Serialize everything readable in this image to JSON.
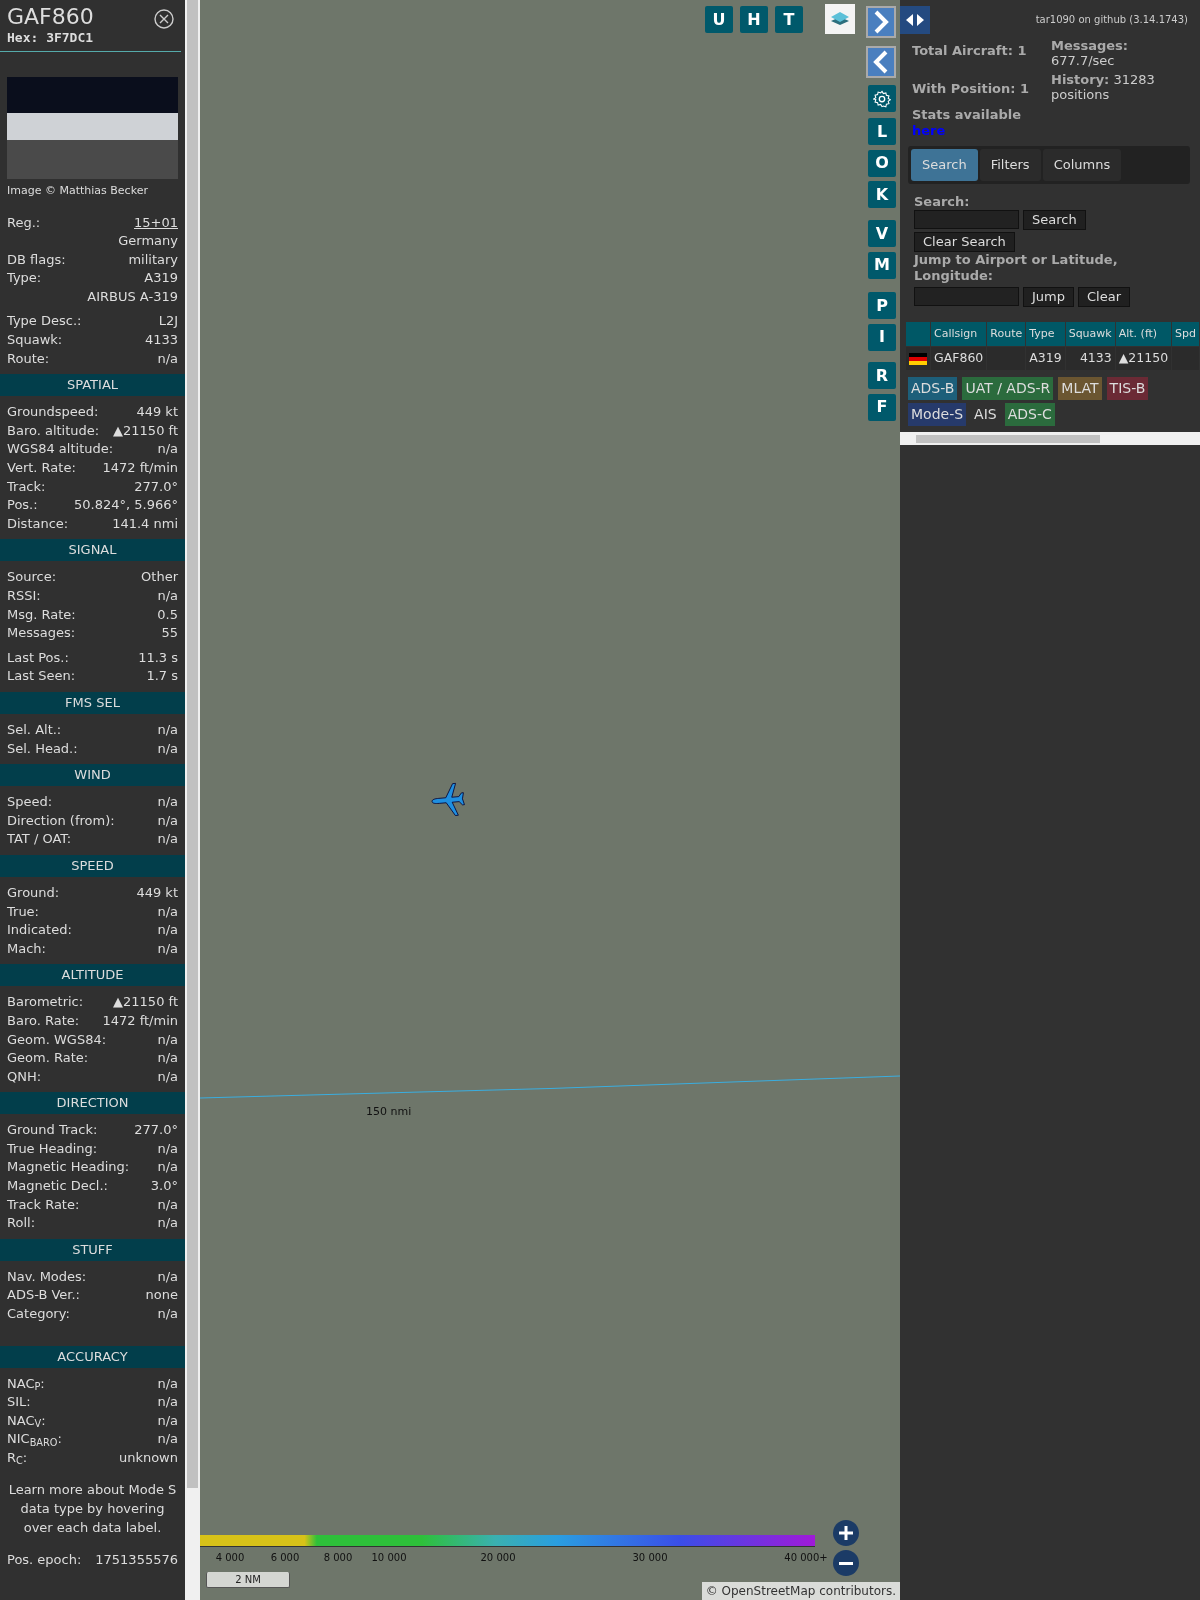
{
  "aircraft": {
    "callsign": "GAF860",
    "hex": "Hex: 3F7DC1",
    "image_credit": "Image © Matthias Becker",
    "groups": [
      [
        {
          "label": "Reg.:",
          "value": "15+01",
          "kind": "link"
        },
        {
          "value": "Germany"
        },
        {
          "label": "DB flags:",
          "value": "military"
        },
        {
          "label": "Type:",
          "value": "A319"
        },
        {
          "value": "AIRBUS A-319"
        }
      ],
      [
        {
          "label": "Type Desc.:",
          "value": "L2J"
        },
        {
          "label": "Squawk:",
          "value": "4133"
        },
        {
          "label": "Route:",
          "value": "n/a"
        }
      ]
    ]
  },
  "sections": [
    {
      "title": "SPATIAL",
      "groups": [
        [
          {
            "label": "Groundspeed:",
            "value": "449 kt"
          },
          {
            "label": "Baro. altitude:",
            "value": "▲21150 ft"
          },
          {
            "label": "WGS84 altitude:",
            "value": "n/a"
          },
          {
            "label": "Vert. Rate:",
            "value": "1472 ft/min"
          },
          {
            "label": "Track:",
            "value": "277.0°"
          },
          {
            "label": "Pos.:",
            "value": "50.824°, 5.966°"
          },
          {
            "label": "Distance:",
            "value": "141.4 nmi"
          }
        ]
      ]
    },
    {
      "title": "SIGNAL",
      "groups": [
        [
          {
            "label": "Source:",
            "value": "Other"
          },
          {
            "label": "RSSI:",
            "value": "n/a"
          },
          {
            "label": "Msg. Rate:",
            "value": "0.5"
          },
          {
            "label": "Messages:",
            "value": "55"
          }
        ],
        [
          {
            "label": "Last Pos.:",
            "value": "11.3 s"
          },
          {
            "label": "Last Seen:",
            "value": "1.7 s"
          }
        ]
      ]
    },
    {
      "title": "FMS SEL",
      "groups": [
        [
          {
            "label": "Sel. Alt.:",
            "value": "n/a"
          },
          {
            "label": "Sel. Head.:",
            "value": "n/a"
          }
        ]
      ]
    },
    {
      "title": "WIND",
      "groups": [
        [
          {
            "label": "Speed:",
            "value": "n/a"
          },
          {
            "label": "Direction (from):",
            "value": "n/a"
          },
          {
            "label": "TAT / OAT:",
            "value": "n/a"
          }
        ]
      ]
    },
    {
      "title": "SPEED",
      "groups": [
        [
          {
            "label": "Ground:",
            "value": "449 kt"
          },
          {
            "label": "True:",
            "value": "n/a"
          },
          {
            "label": "Indicated:",
            "value": "n/a"
          },
          {
            "label": "Mach:",
            "value": "n/a"
          }
        ]
      ]
    },
    {
      "title": "ALTITUDE",
      "groups": [
        [
          {
            "label": "Barometric:",
            "value": "▲21150 ft"
          },
          {
            "label": "Baro. Rate:",
            "value": "1472 ft/min"
          },
          {
            "label": "Geom. WGS84:",
            "value": "n/a"
          },
          {
            "label": "Geom. Rate:",
            "value": "n/a"
          },
          {
            "label": "QNH:",
            "value": "n/a"
          }
        ]
      ]
    },
    {
      "title": "DIRECTION",
      "groups": [
        [
          {
            "label": "Ground Track:",
            "value": "277.0°"
          },
          {
            "label": "True Heading:",
            "value": "n/a"
          },
          {
            "label": "Magnetic Heading:",
            "value": "n/a"
          },
          {
            "label": "Magnetic Decl.:",
            "value": "3.0°"
          },
          {
            "label": "Track Rate:",
            "value": "n/a"
          },
          {
            "label": "Roll:",
            "value": "n/a"
          }
        ]
      ]
    },
    {
      "title": "STUFF",
      "groups": [
        [
          {
            "label": "Nav. Modes:",
            "value": "n/a"
          },
          {
            "label": "ADS-B Ver.:",
            "value": "none"
          },
          {
            "label": "Category:",
            "value": "n/a"
          }
        ]
      ]
    },
    {
      "title": "ACCURACY",
      "groups": [
        [
          {
            "label": "NAC$_{P}$:",
            "value": "n/a"
          },
          {
            "label": "SIL:",
            "value": "n/a"
          },
          {
            "label": "NAC$_{V}$:",
            "value": "n/a"
          },
          {
            "label": "NIC$_{BARO}$:",
            "value": "n/a"
          },
          {
            "label": "R$_{C}$:",
            "value": "unknown"
          }
        ]
      ]
    }
  ],
  "note": "Learn more about Mode S data type by hovering over each data label.",
  "epoch": {
    "label": "Pos. epoch:",
    "value": "1751355576"
  },
  "map": {
    "top_buttons": [
      "U",
      "H",
      "T"
    ],
    "side_buttons": [
      [
        "L",
        "O",
        "K"
      ],
      [
        "V",
        "M"
      ],
      [
        "P",
        "I"
      ],
      [
        "R",
        "F"
      ]
    ],
    "range_label": "150 nmi",
    "altitude_labels": [
      "4 000",
      "6 000",
      "8 000",
      "10 000",
      "20 000",
      "30 000",
      "40 000+"
    ],
    "scale": "2 NM",
    "attribution_prefix": "©",
    "attribution_link": "OpenStreetMap",
    "attribution_suffix": "contributors."
  },
  "panel": {
    "github": "tar1090 on github (3.14.1743)",
    "stats_left": [
      {
        "label": "Total Aircraft:",
        "value": "1"
      },
      {
        "label": "With Position:",
        "value": "1"
      }
    ],
    "stats_right": [
      {
        "label": "Messages:",
        "value": "677.7/sec"
      },
      {
        "label": "History:",
        "value": "31283 positions"
      }
    ],
    "stats_note": "Stats available",
    "stats_link": "here",
    "tabs": [
      {
        "label": "Search",
        "selected": true
      },
      {
        "label": "Filters",
        "selected": false
      },
      {
        "label": "Columns",
        "selected": false
      }
    ],
    "search_label": "Search:",
    "search_button": "Search",
    "clear_search": "Clear Search",
    "jump_label": "Jump to Airport or Latitude, Longitude:",
    "jump_button": "Jump",
    "clear_button": "Clear",
    "table": {
      "columns": [
        "Callsign",
        "Route",
        "Type",
        "Squawk",
        "Alt. (ft)",
        "Spd"
      ],
      "rows": [
        {
          "callsign": "GAF860",
          "route": "",
          "type": "A319",
          "squawk": "4133",
          "alt": "▲21150"
        }
      ]
    },
    "sources": [
      {
        "label": "ADS-B",
        "color": "#1d5f7a"
      },
      {
        "label": "UAT / ADS-R",
        "color": "#2b6b3d"
      },
      {
        "label": "MLAT",
        "color": "#6b5631"
      },
      {
        "label": "TIS-B",
        "color": "#6b2a35"
      },
      {
        "label": "Mode-S",
        "color": "#263a6b"
      },
      {
        "label": "AIS",
        "color": "#313131"
      },
      {
        "label": "ADS-C",
        "color": "#2b6b3d"
      }
    ]
  }
}
